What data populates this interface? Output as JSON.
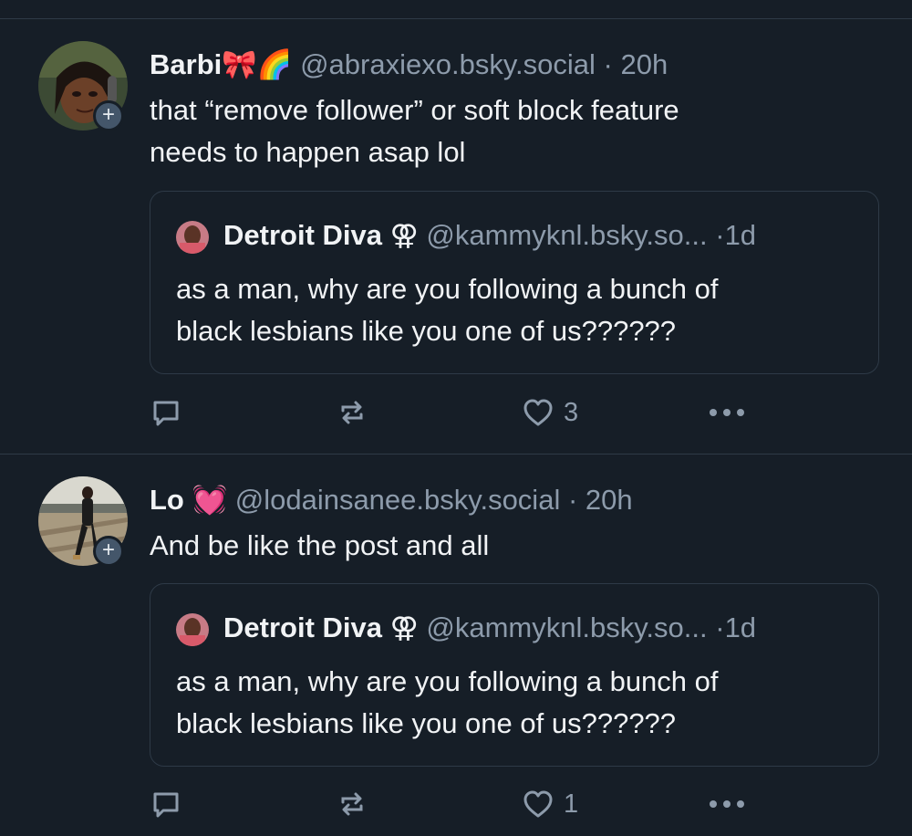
{
  "posts": [
    {
      "author": {
        "display_name": "Barbi",
        "emoji": "🎀🌈",
        "handle": "@abraxiexo.bsky.social",
        "time": "20h"
      },
      "text_lines": [
        "that “remove follower” or soft block feature",
        "needs to happen asap lol"
      ],
      "quote": {
        "display_name": "Detroit Diva",
        "symbol": "⚢",
        "handle": "@kammyknl.bsky.so...",
        "time": "1d",
        "text_lines": [
          "as a man, why are you following a bunch of",
          "black lesbians like you one of us??????"
        ]
      },
      "actions": {
        "like_count": "3"
      },
      "avatar_plus": "+"
    },
    {
      "author": {
        "display_name": "Lo",
        "emoji": "💓",
        "handle": "@lodainsanee.bsky.social",
        "time": "20h"
      },
      "text_lines": [
        "And be like the post and all"
      ],
      "quote": {
        "display_name": "Detroit Diva",
        "symbol": "⚢",
        "handle": "@kammyknl.bsky.so...",
        "time": "1d",
        "text_lines": [
          "as a man, why are you following a bunch of",
          "black lesbians like you one of us??????"
        ]
      },
      "actions": {
        "like_count": "1"
      },
      "avatar_plus": "+"
    }
  ],
  "separator_dot": "·",
  "colors": {
    "background": "#161e27",
    "muted": "#8d9bab",
    "border": "#2e3a47",
    "text": "#f1f3f5"
  },
  "icons": [
    "comment-icon",
    "repost-icon",
    "heart-icon",
    "more-icon",
    "follow-plus-icon"
  ]
}
